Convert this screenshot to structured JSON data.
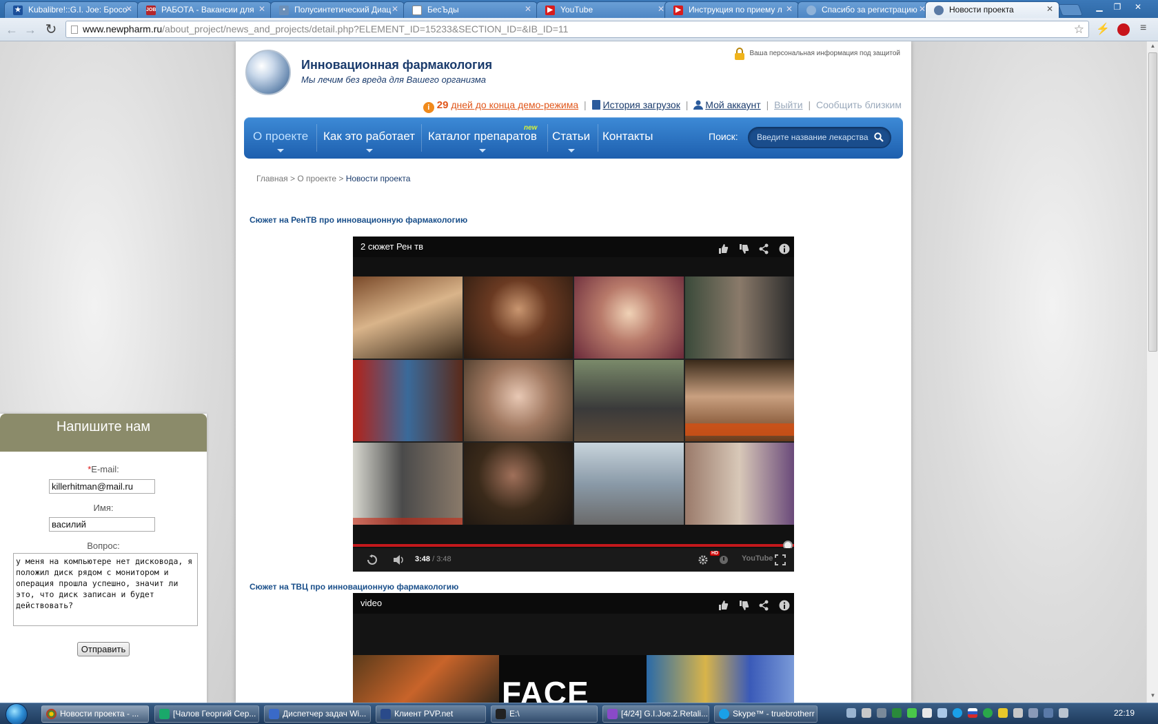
{
  "browser": {
    "tabs": [
      {
        "label": "Kubalibre!::G.I. Joe: Бросо",
        "favicon": "star",
        "color": "#1b4f9a"
      },
      {
        "label": "РАБОТА - Вакансии для",
        "favicon": "job",
        "color": "#b4262b"
      },
      {
        "label": "Полусинтетический Диац",
        "favicon": "pill",
        "color": "#6b8fb8"
      },
      {
        "label": "БесЪды",
        "favicon": "doc",
        "color": "#ffffff"
      },
      {
        "label": "YouTube",
        "favicon": "youtube",
        "color": "#d91c1c"
      },
      {
        "label": "Инструкция по приему л",
        "favicon": "youtube",
        "color": "#d91c1c"
      },
      {
        "label": "Спасибо за регистрацию",
        "favicon": "globe",
        "color": "#8fb2d8"
      },
      {
        "label": "Новости проекта",
        "favicon": "globe",
        "color": "#5a7aa5"
      }
    ],
    "url_host": "www.newpharm.ru",
    "url_path": "/about_project/news_and_projects/detail.php?ELEMENT_ID=15233&SECTION_ID=&IB_ID=11"
  },
  "site": {
    "title": "Инновационная фармакология",
    "tagline": "Мы лечим без вреда для Вашего организма",
    "secure_note": "Ваша персональная информация под защитой"
  },
  "userbar": {
    "days": "29",
    "demo_text": "дней до конца демо-режима",
    "history": "История загрузок",
    "account": "Мой аккаунт",
    "logout": "Выйти",
    "tell_friends": "Сообщить близким"
  },
  "nav": {
    "items": [
      "О проекте",
      "Как это работает",
      "Каталог препаратов",
      "Статьи",
      "Контакты"
    ],
    "new_badge": "new",
    "search_label": "Поиск:",
    "search_placeholder": "Введите название лекарства"
  },
  "breadcrumb": {
    "home": "Главная",
    "sep": ">",
    "about": "О проекте",
    "current": "Новости проекта"
  },
  "videos": [
    {
      "section_title": "Сюжет на РенТВ про инновационную фармакологию",
      "player_title": "2 сюжет Рен тв",
      "time_current": "3:48",
      "time_total": "/ 3:48",
      "progress": 1.0
    },
    {
      "section_title": "Сюжет на ТВЦ про инновационную фармакологию",
      "player_title": "video",
      "thumb_text": "FACE"
    }
  ],
  "feedback": {
    "header": "Напишите нам",
    "email_label": "E-mail:",
    "required_mark": "*",
    "email_value": "killerhitman@mail.ru",
    "name_label": "Имя:",
    "name_value": "василий",
    "question_label": "Вопрос:",
    "question_value": "у меня на компьютере нет дисковода, я положил диск рядом с монитором и операция прошла успешно, значит ли это, что диск записан и будет действовать?",
    "submit": "Отправить"
  },
  "taskbar": {
    "tasks": [
      "Новости проекта - ...",
      "[Чалов Георгий Сер...",
      "Диспетчер задач Wi...",
      "Клиент PVP.net",
      "E:\\",
      "[4/24] G.I.Joe.2.Retali...",
      "Skype™ - truebrotherr"
    ],
    "clock": "22:19"
  }
}
